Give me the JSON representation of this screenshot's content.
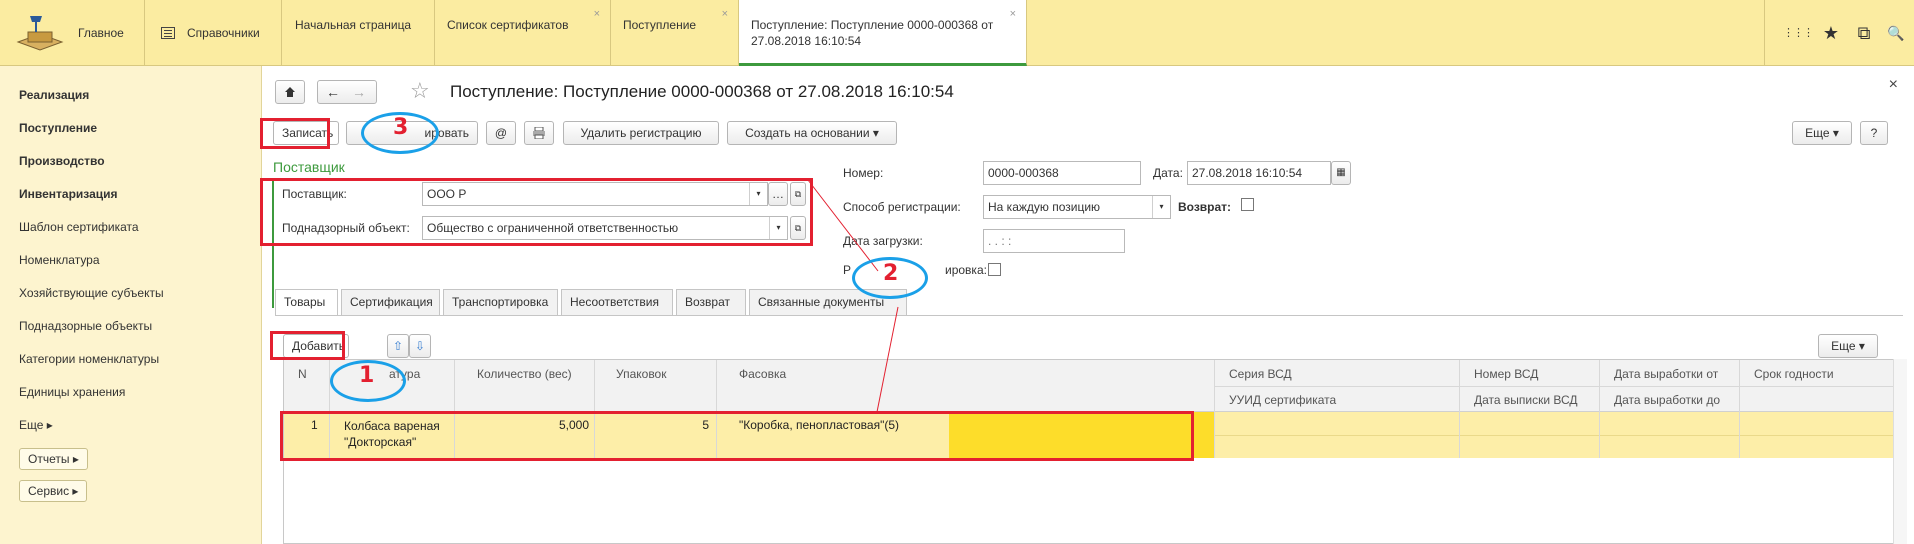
{
  "topbar": {
    "home_label": "Главное",
    "refs_label": "Справочники",
    "tabs": [
      {
        "label": "Начальная страница"
      },
      {
        "label": "Список сертификатов"
      },
      {
        "label": "Поступление"
      },
      {
        "label": "Поступление: Поступление 0000-000368 от 27.08.2018 16:10:54"
      }
    ],
    "close_glyph": "×",
    "right_icons": [
      "⋮⋮⋮",
      "★",
      "⧉",
      "🔍"
    ]
  },
  "sidebar": {
    "items": [
      {
        "label": "Реализация",
        "bold": true
      },
      {
        "label": "Поступление",
        "bold": true
      },
      {
        "label": "Производство",
        "bold": true
      },
      {
        "label": "Инвентаризация",
        "bold": true
      },
      {
        "label": "Шаблон сертификата",
        "bold": false
      },
      {
        "label": "Номенклатура",
        "bold": false
      },
      {
        "label": "Хозяйствующие субъекты",
        "bold": false
      },
      {
        "label": "Поднадзорные объекты",
        "bold": false
      },
      {
        "label": "Категории номенклатуры",
        "bold": false
      },
      {
        "label": "Единицы хранения",
        "bold": false
      },
      {
        "label": "Еще ▸",
        "bold": false
      }
    ],
    "buttons": [
      "Отчеты ▸",
      "Сервис ▸"
    ]
  },
  "form": {
    "title": "Поступление: Поступление 0000-000368 от 27.08.2018 16:10:54",
    "close": "×",
    "toolbar": {
      "write": "Записать",
      "print_partial": "ировать",
      "at": "@",
      "delete_reg": "Удалить регистрацию",
      "create_based": "Создать на основании ▾",
      "more": "Еще ▾",
      "help": "?"
    },
    "supplier_group": "Поставщик",
    "supplier_label": "Поставщик:",
    "supplier_value": "ООО  Р",
    "object_label": "Поднадзорный объект:",
    "object_value": "Общество с ограниченной ответственностью",
    "number_label": "Номер:",
    "number_value": "0000-000368",
    "date_label": "Дата:",
    "date_value": "27.08.2018 16:10:54",
    "reg_method_label": "Способ регистрации:",
    "reg_method_value": "На каждую позицию",
    "return_label": "Возврат:",
    "load_date_label": "Дата загрузки:",
    "load_date_value": ".  .        :  :",
    "partial_label_left": "Р",
    "partial_label_right": "ировка:",
    "tabs": [
      "Товары",
      "Сертификация",
      "Транспортировка",
      "Несоответствия",
      "Возврат",
      "Связанные документы"
    ],
    "add_button": "Добавить",
    "more2": "Еще ▾",
    "table": {
      "headers_top": [
        "N",
        "атура",
        "Количество (вес)",
        "Упаковок",
        "Фасовка",
        "Серия ВСД",
        "Номер ВСД",
        "Дата выработки от",
        "Срок годности"
      ],
      "headers_bottom": [
        "УУИД сертификата",
        "Дата выписки ВСД",
        "Дата выработки до"
      ],
      "rows": [
        {
          "n": "1",
          "name": "Колбаса вареная \"Докторская\"",
          "qty": "5,000",
          "packs": "5",
          "packing": "\"Коробка, пенопластовая\"(5)"
        }
      ]
    },
    "annotations": [
      "1",
      "2",
      "3"
    ]
  },
  "colors": {
    "topbar": "#fbeca1",
    "sidebar": "#fdf4cf",
    "row_selected": "#fdeea8",
    "cell_highlight": "#fddd2a",
    "annotation_red": "#e32030",
    "annotation_blue": "#1aa0e8",
    "group_green": "#3d9a3d"
  }
}
